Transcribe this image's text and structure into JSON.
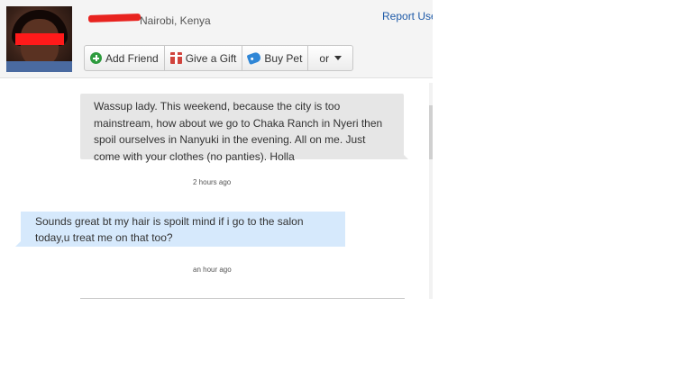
{
  "profile": {
    "location": "Nairobi, Kenya",
    "report_label": "Report Use"
  },
  "actions": {
    "add_friend": "Add Friend",
    "give_gift": "Give a Gift",
    "buy_pet": "Buy Pet",
    "more": "or"
  },
  "messages": [
    {
      "sender": "them",
      "text": "Wassup lady. This weekend, because the city is too mainstream, how about we go to Chaka Ranch in Nyeri then spoil ourselves in Nanyuki in the evening. All on me. Just come with your clothes (no panties). Holla",
      "time": "2 hours ago"
    },
    {
      "sender": "me",
      "text": "Sounds great bt my hair is spoilt mind if i go to the salon today,u treat me on that too?",
      "time": "an hour ago"
    }
  ],
  "colors": {
    "link": "#1e5aa8",
    "their_bubble": "#e6e6e6",
    "my_bubble": "#d6e9fc",
    "redaction": "#ff1a1a"
  },
  "icons": {
    "add_friend": "plus-circle-icon",
    "give_gift": "gift-icon",
    "buy_pet": "tag-icon",
    "more": "caret-down-icon"
  }
}
